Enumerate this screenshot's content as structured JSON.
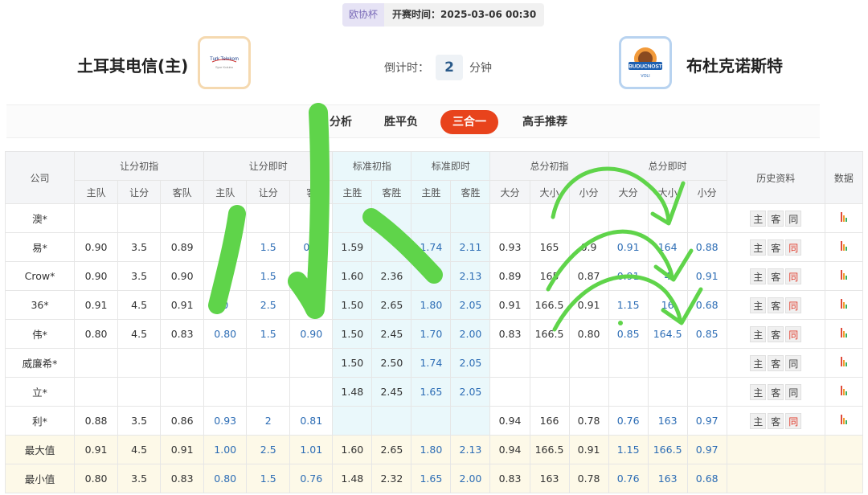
{
  "match": {
    "league": "欧协杯",
    "kickoff_label": "开赛时间：",
    "kickoff_time": "2025-03-06 00:30"
  },
  "home": {
    "name": "土耳其电信(主)",
    "logo_text": "Turk Telekom",
    "logo_subtext": "Spor Kulubu"
  },
  "away": {
    "name": "布杜克诺斯特",
    "logo_text": "BUDUCNOST",
    "logo_subtext": "VOLI"
  },
  "countdown": {
    "label": "倒计时：",
    "value": "2",
    "unit": "分钟"
  },
  "tabs": [
    {
      "label": "分析"
    },
    {
      "label": "胜平负"
    },
    {
      "label": "三合一",
      "active": true
    },
    {
      "label": "高手推荐"
    }
  ],
  "table": {
    "company_header": "公司",
    "group_headers": [
      "让分初指",
      "让分即时",
      "标准初指",
      "标准即时",
      "总分初指",
      "总分即时",
      "历史资料",
      "数据"
    ],
    "sub_headers": [
      "主队",
      "让分",
      "客队",
      "主队",
      "让分",
      "客",
      "主胜",
      "客胜",
      "主胜",
      "客胜",
      "大分",
      "大小",
      "小分",
      "大分",
      "大小",
      "小分"
    ],
    "history_buttons": [
      "主",
      "客",
      "同"
    ],
    "rows": [
      {
        "company": "澳*",
        "v": [
          "",
          "",
          "",
          "",
          "",
          "",
          "",
          "",
          "",
          "",
          "",
          "",
          "",
          "",
          "",
          ""
        ],
        "same_red": false
      },
      {
        "company": "易*",
        "v": [
          "0.90",
          "3.5",
          "0.89",
          "0",
          "1.5",
          "0.9",
          "1.59",
          "",
          "1.74",
          "2.11",
          "0.93",
          "165",
          "0.9",
          "0.91",
          "164",
          "0.88"
        ],
        "same_red": true
      },
      {
        "company": "Crow*",
        "v": [
          "0.90",
          "3.5",
          "0.90",
          "",
          "1.5",
          "1.",
          "1.60",
          "2.36",
          "",
          "2.13",
          "0.89",
          "165",
          "0.87",
          "0.91",
          "4",
          "0.91"
        ],
        "same_red": true
      },
      {
        "company": "36*",
        "v": [
          "0.91",
          "4.5",
          "0.91",
          "0",
          "2.5",
          "",
          "1.50",
          "2.65",
          "1.80",
          "2.05",
          "0.91",
          "166.5",
          "0.91",
          "1.15",
          "16",
          "0.68"
        ],
        "same_red": true
      },
      {
        "company": "伟*",
        "v": [
          "0.80",
          "4.5",
          "0.83",
          "0.80",
          "1.5",
          "0.90",
          "1.50",
          "2.45",
          "1.70",
          "2.00",
          "0.83",
          "166.5",
          "0.80",
          "0.85",
          "164.5",
          "0.85"
        ],
        "same_red": true
      },
      {
        "company": "威廉希*",
        "v": [
          "",
          "",
          "",
          "",
          "",
          "",
          "1.50",
          "2.50",
          "1.74",
          "2.05",
          "",
          "",
          "",
          "",
          "",
          ""
        ],
        "same_red": false
      },
      {
        "company": "立*",
        "v": [
          "",
          "",
          "",
          "",
          "",
          "",
          "1.48",
          "2.45",
          "1.65",
          "2.05",
          "",
          "",
          "",
          "",
          "",
          ""
        ],
        "same_red": false
      },
      {
        "company": "利*",
        "v": [
          "0.88",
          "3.5",
          "0.86",
          "0.93",
          "2",
          "0.81",
          "",
          "",
          "",
          "",
          "0.94",
          "166",
          "0.78",
          "0.76",
          "163",
          "0.97"
        ],
        "same_red": true
      }
    ],
    "summary": [
      {
        "label": "最大值",
        "v": [
          "0.91",
          "4.5",
          "0.91",
          "1.00",
          "2.5",
          "1.01",
          "1.60",
          "2.65",
          "1.80",
          "2.13",
          "0.94",
          "166.5",
          "0.91",
          "1.15",
          "166.5",
          "0.97"
        ]
      },
      {
        "label": "最小值",
        "v": [
          "0.80",
          "3.5",
          "0.83",
          "0.80",
          "1.5",
          "0.76",
          "1.48",
          "2.32",
          "1.65",
          "2.00",
          "0.83",
          "163",
          "0.78",
          "0.76",
          "163",
          "0.68"
        ]
      }
    ]
  },
  "colors": {
    "accent": "#e8431c",
    "blue_value": "#2d6db5",
    "scribble": "#5fd44a"
  }
}
